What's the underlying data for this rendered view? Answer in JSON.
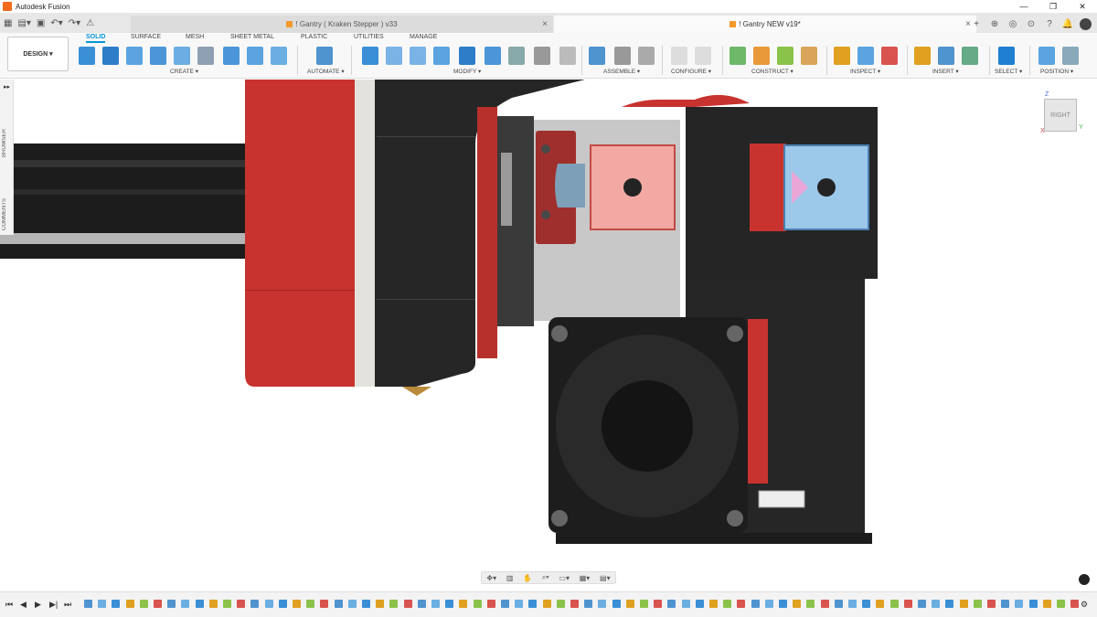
{
  "app": {
    "title": "Autodesk Fusion"
  },
  "window_controls": [
    "—",
    "❐",
    "✕"
  ],
  "tabs": [
    {
      "label": "! Gantry ( Kraken Stepper ) v33",
      "active": false
    },
    {
      "label": "! Gantry NEW v19*",
      "active": true
    }
  ],
  "workspace": {
    "label": "DESIGN ▾"
  },
  "toolbar_tabs": [
    "SOLID",
    "SURFACE",
    "MESH",
    "SHEET METAL",
    "PLASTIC",
    "UTILITIES",
    "MANAGE"
  ],
  "groups": [
    "CREATE ▾",
    "AUTOMATE ▾",
    "MODIFY ▾",
    "ASSEMBLE ▾",
    "CONFIGURE ▾",
    "CONSTRUCT ▾",
    "INSPECT ▾",
    "INSERT ▾",
    "SELECT ▾",
    "POSITION ▾"
  ],
  "side_panels": [
    "BROWSER",
    "COMMENTS"
  ],
  "viewcube": {
    "face": "RIGHT",
    "axes": [
      "Z",
      "X",
      "Y"
    ]
  },
  "colors": {
    "accent": "#0696d7",
    "part_red": "#c8332f",
    "part_black": "#262626",
    "section_red": "#f2a9a4",
    "section_blue": "#9cc8ea"
  }
}
